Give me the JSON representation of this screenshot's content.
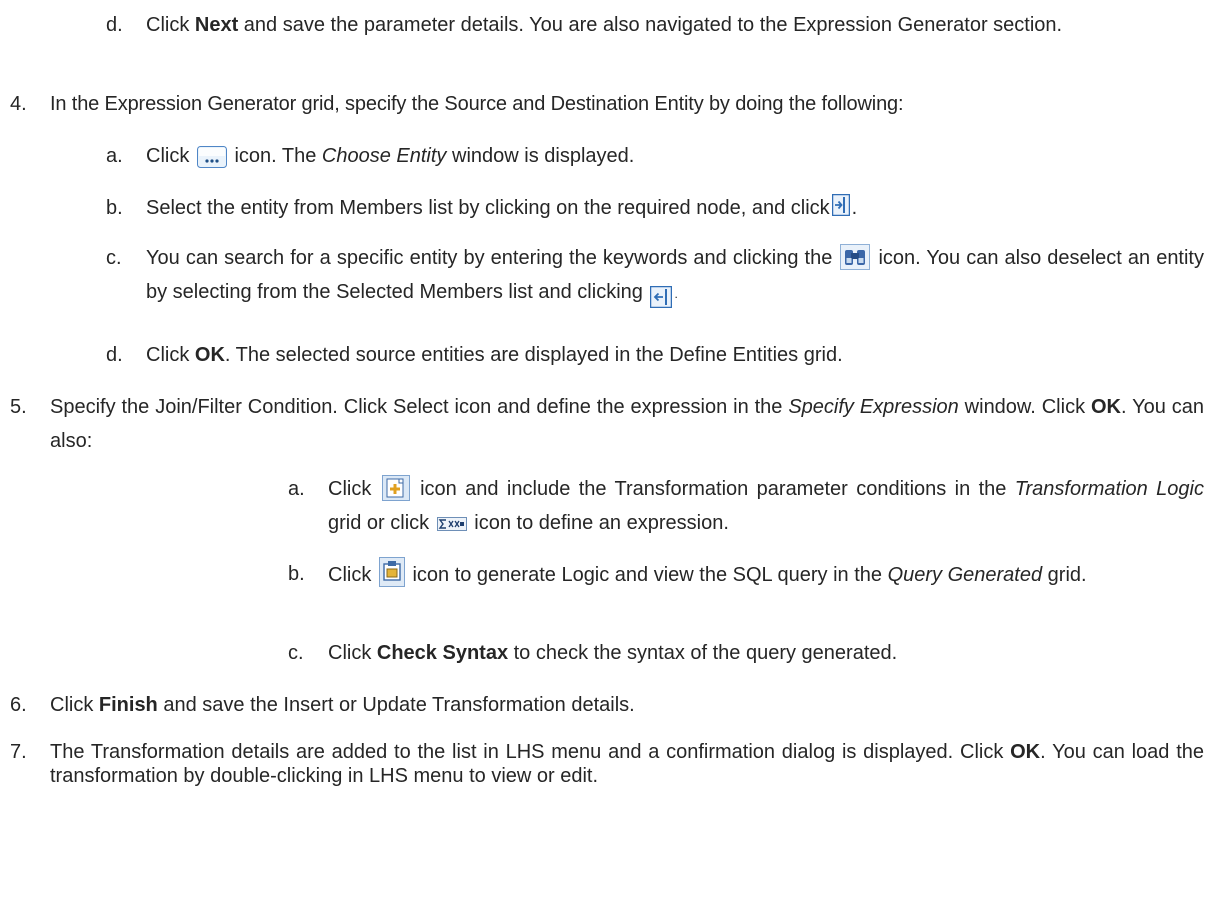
{
  "doc": {
    "step3d": {
      "marker": "d.",
      "t1": "Click ",
      "b1": "Next",
      "t2": " and save the parameter details. You are also navigated to the Expression Generator section."
    },
    "step4": {
      "marker": "4.",
      "text": "In the Expression Generator grid, specify the Source and Destination Entity by doing the following:",
      "a": {
        "marker": "a.",
        "t1": "Click ",
        "t2": " icon. The ",
        "i1": "Choose Entity",
        "t3": " window is displayed."
      },
      "b": {
        "marker": "b.",
        "t1": "Select the entity from Members list by clicking on the required node, and click",
        "t2": "."
      },
      "c": {
        "marker": "c.",
        "t1": "You can search for a specific entity by entering the keywords and clicking the ",
        "t2": " icon. You can also deselect an entity by selecting from the Selected Members list and clicking ",
        "t3": "."
      },
      "d": {
        "marker": "d.",
        "t1": "Click ",
        "b1": "OK",
        "t2": ". The selected source entities are displayed in the Define Entities grid."
      }
    },
    "step5": {
      "marker": "5.",
      "t1": "Specify the Join/Filter Condition. Click Select icon and define the expression in the ",
      "i1": "Specify Expression",
      "t2": " window. Click ",
      "b1": "OK",
      "t3": ". You can also:",
      "a": {
        "marker": "a.",
        "t1": "Click ",
        "t2": " icon and include the Transformation parameter conditions in the ",
        "i1": "Transformation Logic",
        "t3": " grid or click ",
        "t4": " icon to define an expression."
      },
      "b": {
        "marker": "b.",
        "t1": "Click ",
        "t2": " icon to generate Logic and view the SQL query in the ",
        "i1": "Query Generated",
        "t3": " grid."
      },
      "c": {
        "marker": "c.",
        "t1": "Click ",
        "b1": "Check Syntax",
        "t2": " to check the syntax of the query generated."
      }
    },
    "step6": {
      "marker": "6.",
      "t1": "Click ",
      "b1": "Finish",
      "t2": " and save the Insert or Update Transformation details."
    },
    "step7": {
      "marker": "7.",
      "t1": "The Transformation details are added to the list in LHS menu and a confirmation dialog is displayed. Click ",
      "b1": "OK",
      "t2": ". You can load the transformation by double-clicking in LHS menu to view or edit."
    }
  },
  "icons": {
    "browse": "ellipsis-button-icon",
    "move_right": "move-right-icon",
    "search": "binoculars-search-icon",
    "move_left": "move-left-icon",
    "add": "add-parameter-icon",
    "expression": "sigma-expression-icon",
    "generate": "generate-query-icon"
  }
}
